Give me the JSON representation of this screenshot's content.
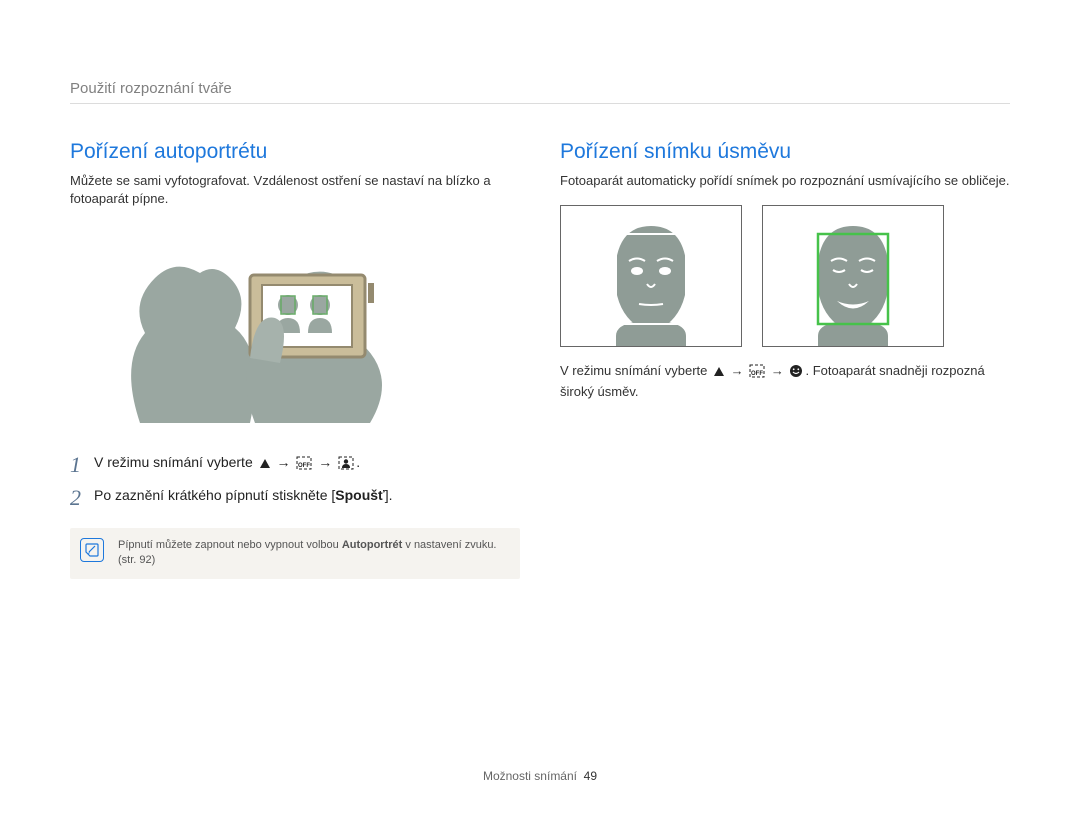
{
  "breadcrumb": "Použití rozpoznání tváře",
  "left": {
    "title": "Pořízení autoportrétu",
    "body": "Můžete se sami vyfotografovat. Vzdálenost ostření se nastaví na blízko a fotoaparát pípne.",
    "step1_prefix": "V režimu snímání vyberte ",
    "step1_suffix": ".",
    "step2_prefix": "Po zaznění krátkého pípnutí stiskněte [",
    "step2_bold": "Spoušť",
    "step2_suffix": "].",
    "note_prefix": "Pípnutí můžete zapnout nebo vypnout volbou ",
    "note_bold": "Autoportrét",
    "note_suffix": " v nastavení zvuku. (str. 92)"
  },
  "right": {
    "title": "Pořízení snímku úsměvu",
    "body": "Fotoaparát automaticky pořídí snímek po rozpoznání usmívajícího se obličeje.",
    "hint_prefix": "V režimu snímání vyberte ",
    "hint_suffix1": ". Fotoaparát snadněji rozpozná široký úsměv."
  },
  "footer": {
    "label": "Možnosti snímání",
    "page": "49"
  }
}
